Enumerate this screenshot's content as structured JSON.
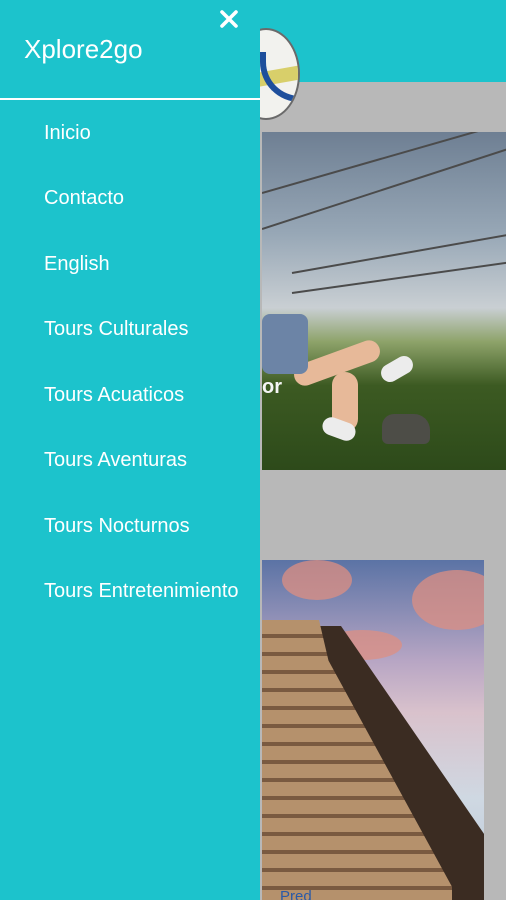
{
  "drawer": {
    "title": "Xplore2go",
    "close_icon": "close-icon",
    "menu": [
      {
        "label": "Inicio"
      },
      {
        "label": "Contacto"
      },
      {
        "label": "English"
      },
      {
        "label": "Tours Culturales"
      },
      {
        "label": "Tours Acuaticos"
      },
      {
        "label": "Tours Aventuras"
      },
      {
        "label": "Tours Nocturnos"
      },
      {
        "label": "Tours Entretenimiento"
      }
    ]
  },
  "background": {
    "card_1_caption": "or",
    "card_2_caption": "Pred"
  },
  "colors": {
    "accent": "#1cc3cc",
    "drawer_text": "#ffffff",
    "background": "#b8b8b8"
  }
}
